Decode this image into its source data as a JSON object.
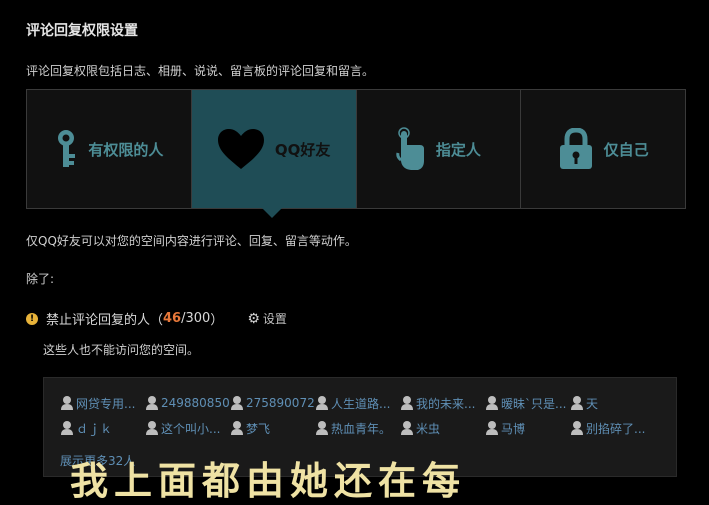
{
  "page": {
    "title": "评论回复权限设置",
    "description": "评论回复权限包括日志、相册、说说、留言板的评论回复和留言。",
    "options": [
      {
        "label": "有权限的人",
        "icon": "key-icon"
      },
      {
        "label": "QQ好友",
        "icon": "heart-icon",
        "selected": true
      },
      {
        "label": "指定人",
        "icon": "pointing-hand-icon"
      },
      {
        "label": "仅自己",
        "icon": "lock-icon"
      }
    ],
    "selected_note": "仅QQ好友可以对您的空间内容进行评论、回复、留言等动作。",
    "except_label": "除了:",
    "forbidden": {
      "label": "禁止评论回复的人（",
      "current": "46",
      "separator": "/",
      "max": "300",
      "close": "）",
      "settings_label": "设置",
      "sub_note": "这些人也不能访问您的空间。",
      "users": [
        "网贷专用...",
        "249880850",
        "275890072",
        "人生道路...",
        "我的未来...",
        "暧昧`只是...",
        "天",
        "ｄｊｋ",
        "这个叫小...",
        "梦飞",
        "热血青年。",
        "米虫",
        "马博",
        "别掐碎了..."
      ],
      "show_more": "展示更多32人"
    },
    "overlay_text": "我上面都由她还在每"
  },
  "colors": {
    "background": "#000000",
    "accent": "#1f4d56",
    "icon_color": "#4d8d96",
    "count_current": "#e7783a",
    "link": "#5f8fb5"
  }
}
